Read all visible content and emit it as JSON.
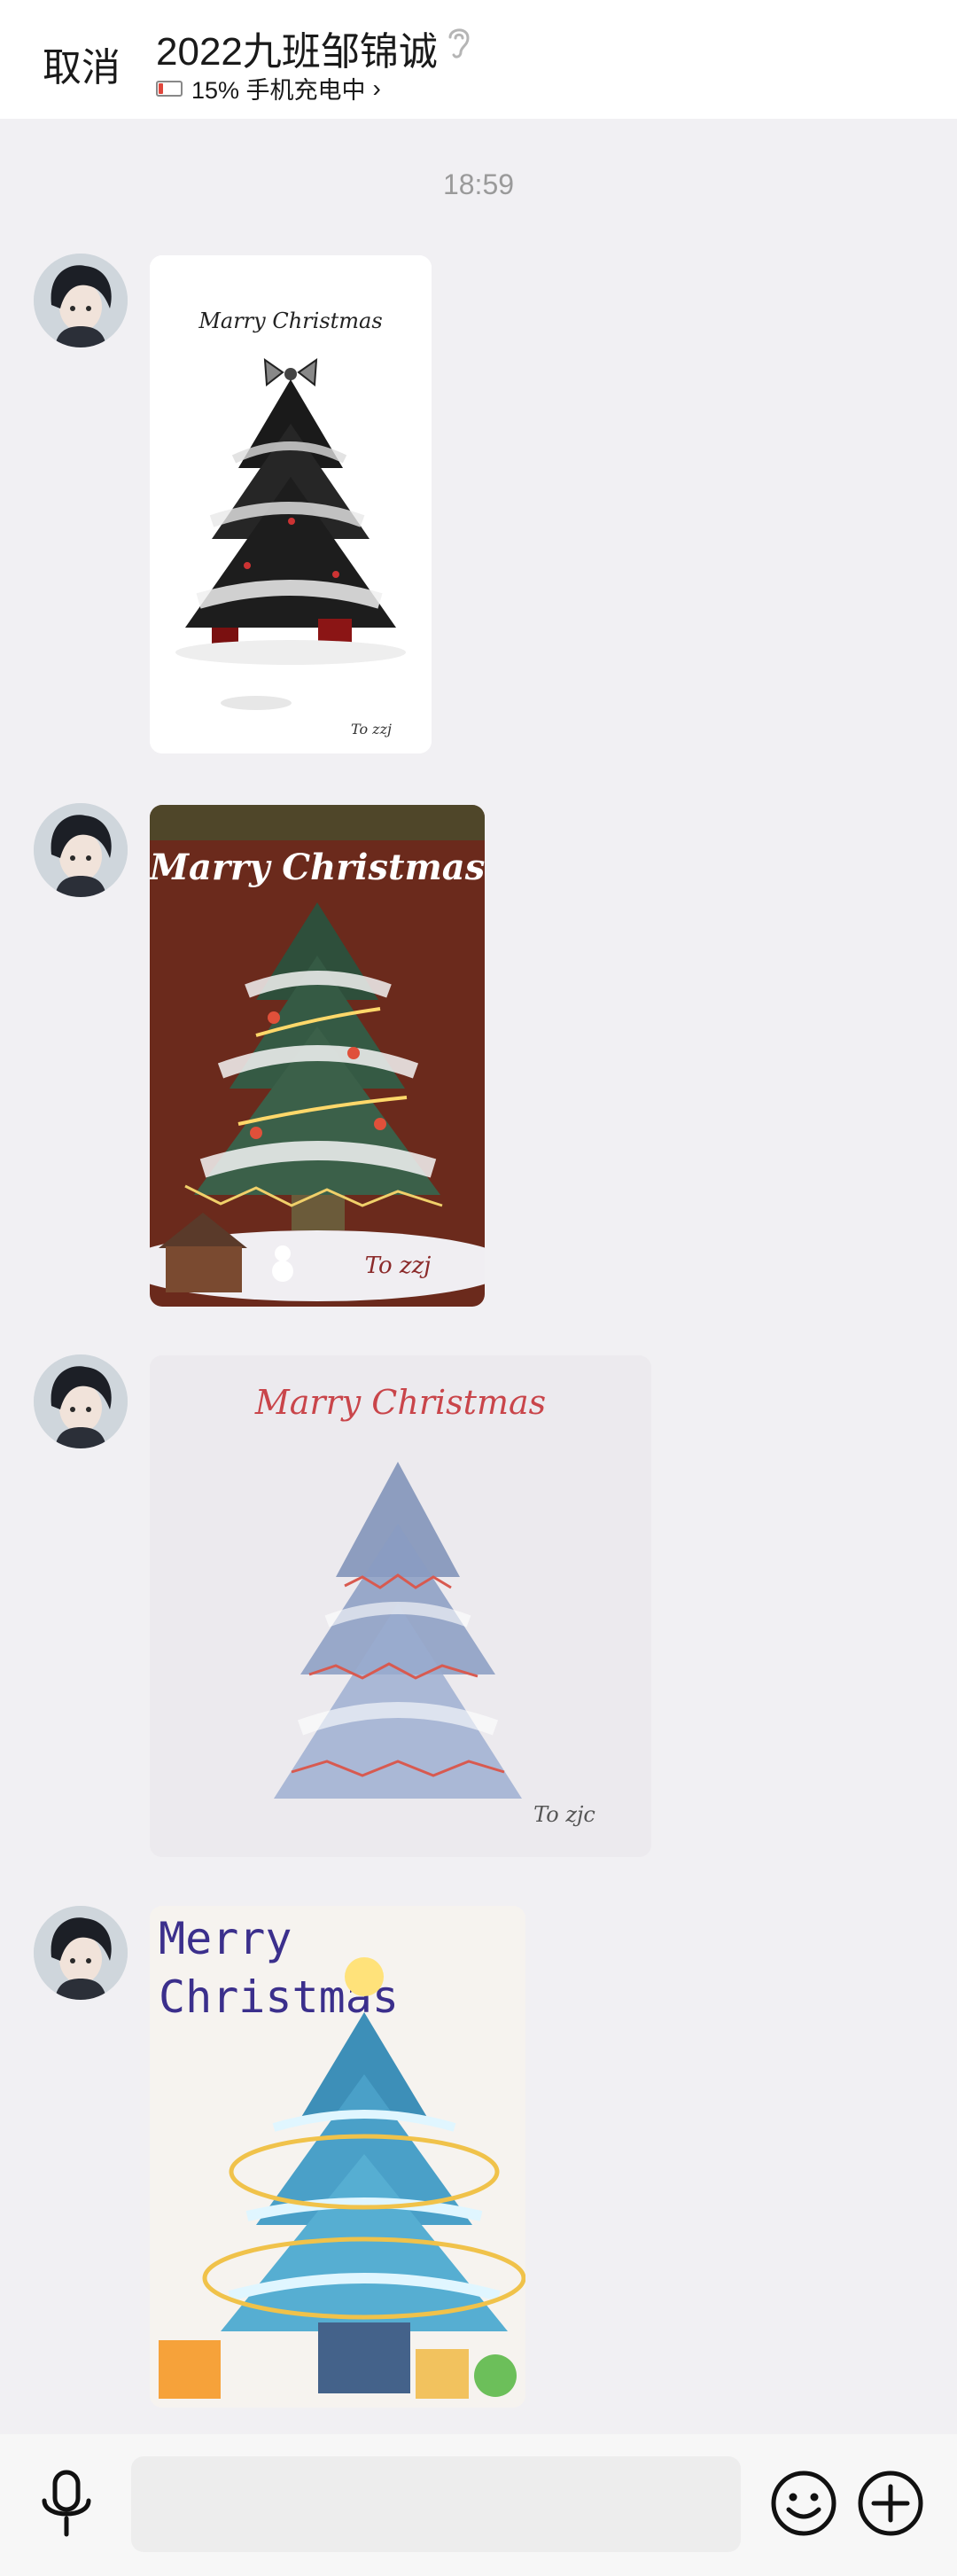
{
  "header": {
    "cancel_label": "取消",
    "title": "2022九班邹锦诚",
    "status_text": "15% 手机充电中",
    "icons": [
      "ear-icon",
      "battery-icon",
      "chevron-right-icon"
    ]
  },
  "conversation": {
    "timestamp": "18:59",
    "messages": [
      {
        "type": "image",
        "card_text": "Marry Christmas",
        "signature": "To zzj"
      },
      {
        "type": "image",
        "card_text": "Marry Christmas",
        "signature": "To zzj"
      },
      {
        "type": "image",
        "card_text": "Marry Christmas",
        "signature": "To zjc"
      },
      {
        "type": "image",
        "card_text_line1": "Merry",
        "card_text_line2": "Christmas"
      }
    ]
  },
  "composer": {
    "icons": [
      "microphone-icon",
      "emoji-icon",
      "plus-icon"
    ],
    "input_value": ""
  },
  "colors": {
    "header_bg": "#ffffff",
    "chat_bg": "#f1f0f3",
    "card2_bg": "#6b2a1c",
    "card3_title": "#c9454a"
  }
}
